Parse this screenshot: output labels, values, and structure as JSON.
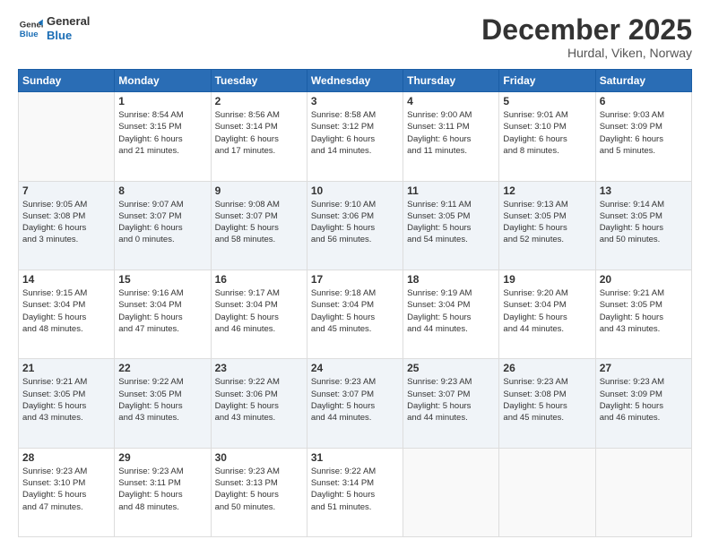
{
  "logo": {
    "line1": "General",
    "line2": "Blue"
  },
  "header": {
    "month": "December 2025",
    "location": "Hurdal, Viken, Norway"
  },
  "days": [
    "Sunday",
    "Monday",
    "Tuesday",
    "Wednesday",
    "Thursday",
    "Friday",
    "Saturday"
  ],
  "weeks": [
    [
      {
        "day": "",
        "info": ""
      },
      {
        "day": "1",
        "info": "Sunrise: 8:54 AM\nSunset: 3:15 PM\nDaylight: 6 hours\nand 21 minutes."
      },
      {
        "day": "2",
        "info": "Sunrise: 8:56 AM\nSunset: 3:14 PM\nDaylight: 6 hours\nand 17 minutes."
      },
      {
        "day": "3",
        "info": "Sunrise: 8:58 AM\nSunset: 3:12 PM\nDaylight: 6 hours\nand 14 minutes."
      },
      {
        "day": "4",
        "info": "Sunrise: 9:00 AM\nSunset: 3:11 PM\nDaylight: 6 hours\nand 11 minutes."
      },
      {
        "day": "5",
        "info": "Sunrise: 9:01 AM\nSunset: 3:10 PM\nDaylight: 6 hours\nand 8 minutes."
      },
      {
        "day": "6",
        "info": "Sunrise: 9:03 AM\nSunset: 3:09 PM\nDaylight: 6 hours\nand 5 minutes."
      }
    ],
    [
      {
        "day": "7",
        "info": "Sunrise: 9:05 AM\nSunset: 3:08 PM\nDaylight: 6 hours\nand 3 minutes."
      },
      {
        "day": "8",
        "info": "Sunrise: 9:07 AM\nSunset: 3:07 PM\nDaylight: 6 hours\nand 0 minutes."
      },
      {
        "day": "9",
        "info": "Sunrise: 9:08 AM\nSunset: 3:07 PM\nDaylight: 5 hours\nand 58 minutes."
      },
      {
        "day": "10",
        "info": "Sunrise: 9:10 AM\nSunset: 3:06 PM\nDaylight: 5 hours\nand 56 minutes."
      },
      {
        "day": "11",
        "info": "Sunrise: 9:11 AM\nSunset: 3:05 PM\nDaylight: 5 hours\nand 54 minutes."
      },
      {
        "day": "12",
        "info": "Sunrise: 9:13 AM\nSunset: 3:05 PM\nDaylight: 5 hours\nand 52 minutes."
      },
      {
        "day": "13",
        "info": "Sunrise: 9:14 AM\nSunset: 3:05 PM\nDaylight: 5 hours\nand 50 minutes."
      }
    ],
    [
      {
        "day": "14",
        "info": "Sunrise: 9:15 AM\nSunset: 3:04 PM\nDaylight: 5 hours\nand 48 minutes."
      },
      {
        "day": "15",
        "info": "Sunrise: 9:16 AM\nSunset: 3:04 PM\nDaylight: 5 hours\nand 47 minutes."
      },
      {
        "day": "16",
        "info": "Sunrise: 9:17 AM\nSunset: 3:04 PM\nDaylight: 5 hours\nand 46 minutes."
      },
      {
        "day": "17",
        "info": "Sunrise: 9:18 AM\nSunset: 3:04 PM\nDaylight: 5 hours\nand 45 minutes."
      },
      {
        "day": "18",
        "info": "Sunrise: 9:19 AM\nSunset: 3:04 PM\nDaylight: 5 hours\nand 44 minutes."
      },
      {
        "day": "19",
        "info": "Sunrise: 9:20 AM\nSunset: 3:04 PM\nDaylight: 5 hours\nand 44 minutes."
      },
      {
        "day": "20",
        "info": "Sunrise: 9:21 AM\nSunset: 3:05 PM\nDaylight: 5 hours\nand 43 minutes."
      }
    ],
    [
      {
        "day": "21",
        "info": "Sunrise: 9:21 AM\nSunset: 3:05 PM\nDaylight: 5 hours\nand 43 minutes."
      },
      {
        "day": "22",
        "info": "Sunrise: 9:22 AM\nSunset: 3:05 PM\nDaylight: 5 hours\nand 43 minutes."
      },
      {
        "day": "23",
        "info": "Sunrise: 9:22 AM\nSunset: 3:06 PM\nDaylight: 5 hours\nand 43 minutes."
      },
      {
        "day": "24",
        "info": "Sunrise: 9:23 AM\nSunset: 3:07 PM\nDaylight: 5 hours\nand 44 minutes."
      },
      {
        "day": "25",
        "info": "Sunrise: 9:23 AM\nSunset: 3:07 PM\nDaylight: 5 hours\nand 44 minutes."
      },
      {
        "day": "26",
        "info": "Sunrise: 9:23 AM\nSunset: 3:08 PM\nDaylight: 5 hours\nand 45 minutes."
      },
      {
        "day": "27",
        "info": "Sunrise: 9:23 AM\nSunset: 3:09 PM\nDaylight: 5 hours\nand 46 minutes."
      }
    ],
    [
      {
        "day": "28",
        "info": "Sunrise: 9:23 AM\nSunset: 3:10 PM\nDaylight: 5 hours\nand 47 minutes."
      },
      {
        "day": "29",
        "info": "Sunrise: 9:23 AM\nSunset: 3:11 PM\nDaylight: 5 hours\nand 48 minutes."
      },
      {
        "day": "30",
        "info": "Sunrise: 9:23 AM\nSunset: 3:13 PM\nDaylight: 5 hours\nand 50 minutes."
      },
      {
        "day": "31",
        "info": "Sunrise: 9:22 AM\nSunset: 3:14 PM\nDaylight: 5 hours\nand 51 minutes."
      },
      {
        "day": "",
        "info": ""
      },
      {
        "day": "",
        "info": ""
      },
      {
        "day": "",
        "info": ""
      }
    ]
  ]
}
